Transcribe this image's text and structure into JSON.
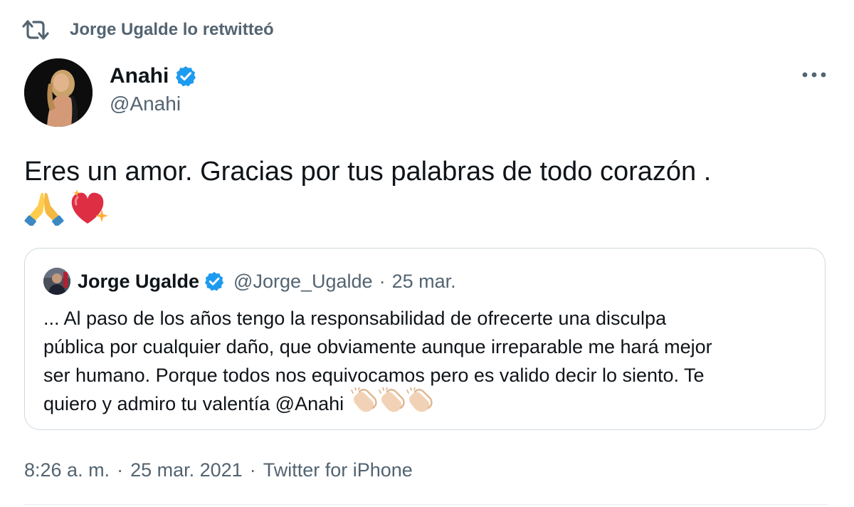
{
  "retweet": {
    "icon": "retweet-icon",
    "text": "Jorge Ugalde lo retwitteó"
  },
  "author": {
    "name": "Anahi",
    "handle": "@Anahi",
    "verified": true
  },
  "tweet": {
    "text": "Eres un amor. Gracias por tus palabras de todo corazón .",
    "emojis": [
      "folded-hands-icon",
      "sparkling-heart-icon"
    ]
  },
  "quote": {
    "name": "Jorge Ugalde",
    "handle": "@Jorge_Ugalde",
    "separator": "·",
    "date": "25 mar.",
    "lines": [
      "... Al paso de los años tengo la responsabilidad de ofrecerte una disculpa",
      "pública por cualquier daño, que obviamente aunque irreparable me hará mejor",
      "ser humano. Porque todos nos equivocamos pero es valido decir lo siento. Te",
      "quiero y admiro tu valentía @Anahi"
    ],
    "clap_count": 3
  },
  "meta": {
    "time": "8:26 a. m.",
    "separator": "·",
    "date": "25 mar. 2021",
    "source": "Twitter for iPhone"
  },
  "colors": {
    "text_primary": "#0f1419",
    "text_secondary": "#536471",
    "verified_blue": "#1d9bf0",
    "border": "#cfd9de"
  }
}
